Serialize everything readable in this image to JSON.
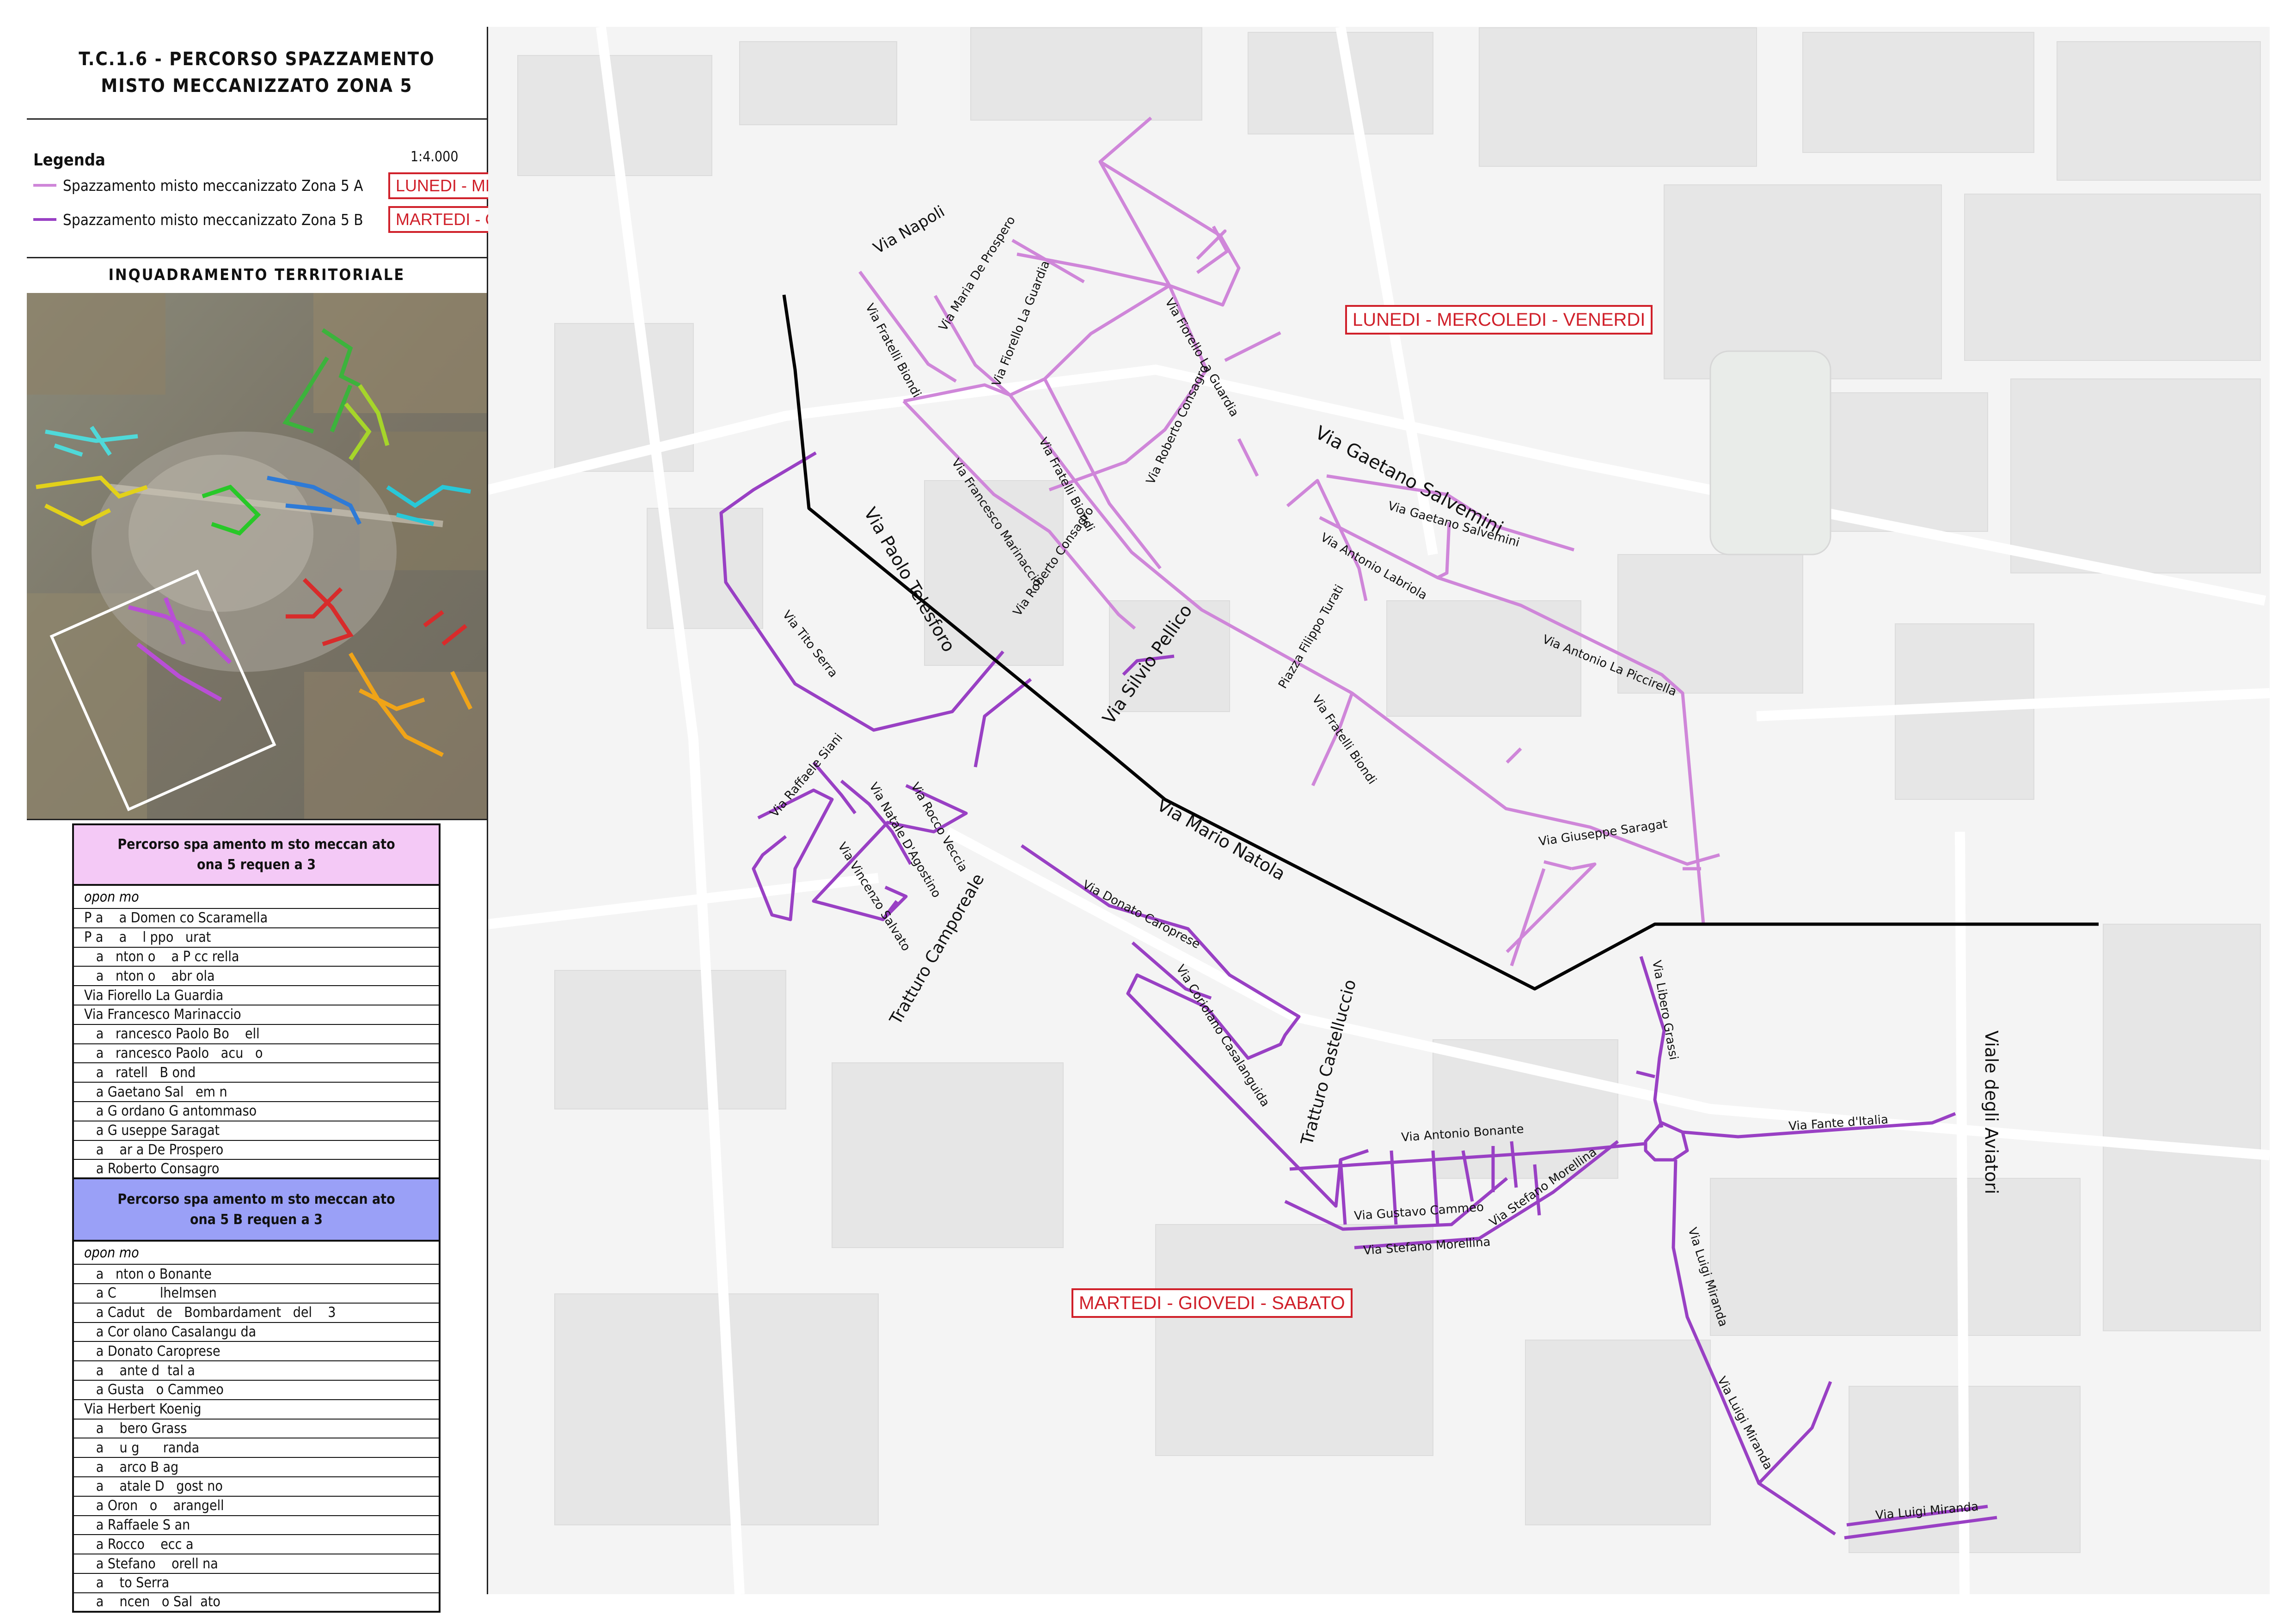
{
  "title": {
    "line1": "T.C.1.6 - PERCORSO SPAZZAMENTO",
    "line2": "MISTO MECCANIZZATO ZONA 5"
  },
  "legend": {
    "heading": "Legenda",
    "scale": "1:4.000",
    "items": [
      {
        "label": "Spazzamento misto meccanizzato Zona 5 A",
        "color": "#cf86d9",
        "days": "LUNEDI - MERCOLEDI - VENERDI"
      },
      {
        "label": "Spazzamento misto meccanizzato Zona 5 B",
        "color": "#9940c4",
        "days": "MARTEDI - GIOVEDI - SABATO"
      }
    ]
  },
  "inquadramento": {
    "heading": "INQUADRAMENTO TERRITORIALE"
  },
  "table_a": {
    "header_line1": "Percorso spa    amento m sto meccan     ato",
    "header_line2": "ona 5         requen  a 3",
    "header_color": "#f4c9f6",
    "sub": "opon mo",
    "rows": [
      "P a    a Domen co Scaramella",
      "P a    a    l ppo   urat",
      "   a   nton o    a P cc rella",
      "   a   nton o    abr ola",
      "Via Fiorello La Guardia",
      "Via Francesco Marinaccio",
      "   a   rancesco Paolo Bo    ell",
      "   a   rancesco Paolo   acu   o",
      "   a   ratell   B ond",
      "   a Gaetano Sal   em n",
      "   a G ordano G antommaso",
      "   a G useppe Saragat",
      "   a    ar a De Prospero",
      "   a Roberto Consagro"
    ]
  },
  "table_b": {
    "header_line1": "Percorso spa    amento m sto meccan     ato",
    "header_line2": "ona 5 B      requen  a 3",
    "header_color": "#9aa0f7",
    "sub": "opon mo",
    "rows": [
      "   a   nton o Bonante",
      "   a C           lhelmsen",
      "   a Cadut   de   Bombardament   del    3",
      "   a Cor olano Casalangu da",
      "   a Donato Caroprese",
      "   a    ante d  tal a",
      "   a Gusta   o Cammeo",
      "Via Herbert Koenig",
      "   a    bero Grass",
      "   a    u g      randa",
      "   a    arco B ag",
      "   a    atale D   gost no",
      "   a Oron   o    arangell",
      "   a Raffaele S an",
      "   a Rocco    ecc a",
      "   a Stefano    orell na",
      "   a    to Serra",
      "   a    ncen   o Sal  ato"
    ]
  },
  "map": {
    "label_zone_a": "LUNEDI - MERCOLEDI - VENERDI",
    "label_zone_b": "MARTEDI - GIOVEDI - SABATO",
    "streets": [
      "Via Napoli",
      "Via Fratelli Biondi",
      "Via Maria De Prospero",
      "Via Fiorello La Guardia",
      "Via Fiorello La Guardia",
      "Via Gaetano Salvemini",
      "Via Gaetano Salvemini",
      "Via Roberto Consagro",
      "Via Francesco Marinaccio",
      "Via Fratelli Biondi",
      "Via Roberto Consagro",
      "Via Antonio Labriola",
      "Piazza Filippo Turati",
      "Via Antonio La Piccirella",
      "Via Fratelli Biondi",
      "Via Paolo Telesforo",
      "Via Tito Serra",
      "Via Silvio Pellico",
      "Via Mario Natola",
      "Via Giuseppe Saragat",
      "Via Raffaele Siani",
      "Via Natale D'Agostino",
      "Via Rocco Veccia",
      "Via Vincenzo Salvato",
      "Tratturo Camporeale",
      "Via Donato Caroprese",
      "Via Coriolano Casalanguida",
      "Tratturo Castelluccio",
      "Via Libero Grassi",
      "Via Antonio Bonante",
      "Via Fante d'Italia",
      "Viale degli Aviatori",
      "Via Gustavo Cammeo",
      "Via Stefano Morellina",
      "Via Stefano Morellina",
      "Via Luigi Miranda",
      "Via Luigi Miranda",
      "Via Luigi Miranda"
    ]
  }
}
